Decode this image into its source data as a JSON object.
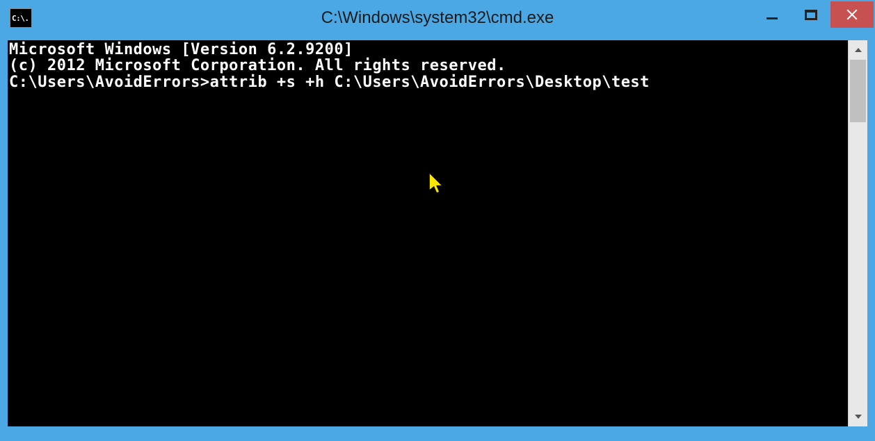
{
  "window": {
    "title": "C:\\Windows\\system32\\cmd.exe",
    "app_icon_label": "C:\\."
  },
  "terminal": {
    "line1": "Microsoft Windows [Version 6.2.9200]",
    "line2": "(c) 2012 Microsoft Corporation. All rights reserved.",
    "blank": "",
    "prompt_line": "C:\\Users\\AvoidErrors>attrib +s +h C:\\Users\\AvoidErrors\\Desktop\\test"
  },
  "controls": {
    "minimize": "Minimize",
    "maximize": "Maximize",
    "close": "Close"
  }
}
